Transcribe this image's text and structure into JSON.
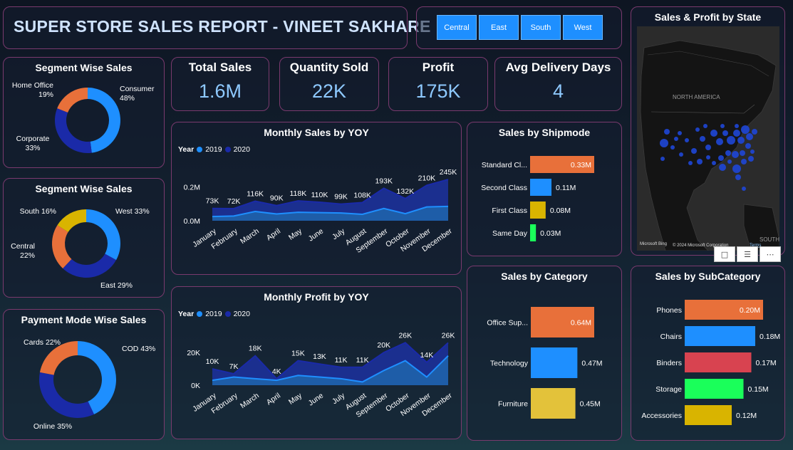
{
  "header": {
    "title": "SUPER STORE SALES REPORT - VINEET SAKHARE"
  },
  "regions": [
    "Central",
    "East",
    "South",
    "West"
  ],
  "kpis": [
    {
      "title": "Total Sales",
      "value": "1.6M"
    },
    {
      "title": "Quantity Sold",
      "value": "22K"
    },
    {
      "title": "Profit",
      "value": "175K"
    },
    {
      "title": "Avg Delivery Days",
      "value": "4"
    }
  ],
  "colors": {
    "accent_blue": "#1e8fff",
    "navy": "#1a2aa8",
    "orange": "#e8703a",
    "yellow": "#d9b400",
    "border": "#7a3a6e"
  },
  "segment_sales": {
    "title": "Segment Wise Sales",
    "slices": [
      {
        "name": "Consumer",
        "pct": "48%",
        "value": 48,
        "color": "#1e8fff"
      },
      {
        "name": "Corporate",
        "pct": "33%",
        "value": 33,
        "color": "#1a2aa8"
      },
      {
        "name": "Home Office",
        "pct": "19%",
        "value": 19,
        "color": "#e8703a"
      }
    ]
  },
  "region_sales": {
    "title": "Segment Wise Sales",
    "slices": [
      {
        "name": "West",
        "pct": "33%",
        "value": 33,
        "color": "#1e8fff"
      },
      {
        "name": "East",
        "pct": "29%",
        "value": 29,
        "color": "#1a2aa8"
      },
      {
        "name": "Central",
        "pct": "22%",
        "value": 22,
        "color": "#e8703a"
      },
      {
        "name": "South",
        "pct": "16%",
        "value": 16,
        "color": "#d9b400"
      }
    ]
  },
  "payment_sales": {
    "title": "Payment Mode Wise Sales",
    "slices": [
      {
        "name": "COD",
        "pct": "43%",
        "value": 43,
        "color": "#1e8fff"
      },
      {
        "name": "Online",
        "pct": "35%",
        "value": 35,
        "color": "#1a2aa8"
      },
      {
        "name": "Cards",
        "pct": "22%",
        "value": 22,
        "color": "#e8703a"
      }
    ]
  },
  "legend": {
    "title": "Year",
    "items": [
      {
        "label": "2019",
        "color": "#1e8fff"
      },
      {
        "label": "2020",
        "color": "#1a2aa8"
      }
    ]
  },
  "monthly_sales": {
    "title": "Monthly Sales by YOY",
    "months": [
      "January",
      "February",
      "March",
      "April",
      "May",
      "June",
      "July",
      "August",
      "September",
      "October",
      "November",
      "December"
    ],
    "s2020": [
      0.073,
      0.072,
      0.116,
      0.09,
      0.118,
      0.11,
      0.099,
      0.108,
      0.193,
      0.132,
      0.21,
      0.245
    ],
    "s2019": [
      0.025,
      0.028,
      0.055,
      0.04,
      0.05,
      0.048,
      0.046,
      0.038,
      0.073,
      0.042,
      0.082,
      0.085
    ],
    "labels": [
      "73K",
      "72K",
      "116K",
      "90K",
      "118K",
      "110K",
      "99K",
      "108K",
      "193K",
      "132K",
      "210K",
      "245K"
    ],
    "yticks": [
      "0.2M",
      "0.0M"
    ]
  },
  "monthly_profit": {
    "title": "Monthly Profit by YOY",
    "months": [
      "January",
      "February",
      "March",
      "April",
      "May",
      "June",
      "July",
      "August",
      "September",
      "October",
      "November",
      "December"
    ],
    "s2020": [
      10,
      7,
      18,
      4,
      15,
      13,
      11,
      11,
      20,
      26,
      14,
      26
    ],
    "s2019": [
      3,
      5,
      4,
      3,
      6,
      5,
      4,
      2,
      9,
      15,
      5,
      18
    ],
    "labels": [
      "10K",
      "7K",
      "18K",
      "4K",
      "15K",
      "13K",
      "11K",
      "11K",
      "20K",
      "26K",
      "14K",
      "26K"
    ],
    "yticks": [
      "20K",
      "0K"
    ]
  },
  "shipmode": {
    "title": "Sales by Shipmode",
    "bars": [
      {
        "label": "Standard Cl...",
        "value": 0.33,
        "text": "0.33M",
        "color": "#e8703a"
      },
      {
        "label": "Second Class",
        "value": 0.11,
        "text": "0.11M",
        "color": "#1e8fff"
      },
      {
        "label": "First Class",
        "value": 0.08,
        "text": "0.08M",
        "color": "#d9b400"
      },
      {
        "label": "Same Day",
        "value": 0.03,
        "text": "0.03M",
        "color": "#1aff5a"
      }
    ]
  },
  "category": {
    "title": "Sales by Category",
    "bars": [
      {
        "label": "Office Sup...",
        "value": 0.64,
        "text": "0.64M",
        "color": "#e8703a"
      },
      {
        "label": "Technology",
        "value": 0.47,
        "text": "0.47M",
        "color": "#1e8fff"
      },
      {
        "label": "Furniture",
        "value": 0.45,
        "text": "0.45M",
        "color": "#e3c23a"
      }
    ]
  },
  "subcategory": {
    "title": "Sales by SubCategory",
    "bars": [
      {
        "label": "Phones",
        "value": 0.2,
        "text": "0.20M",
        "color": "#e8703a"
      },
      {
        "label": "Chairs",
        "value": 0.18,
        "text": "0.18M",
        "color": "#1e8fff"
      },
      {
        "label": "Binders",
        "value": 0.17,
        "text": "0.17M",
        "color": "#d84350"
      },
      {
        "label": "Storage",
        "value": 0.15,
        "text": "0.15M",
        "color": "#1aff5a"
      },
      {
        "label": "Accessories",
        "value": 0.12,
        "text": "0.12M",
        "color": "#d9b400"
      }
    ]
  },
  "map": {
    "title": "Sales & Profit by State",
    "region_label": "NORTH AMERICA",
    "south_label": "SOUTH",
    "brand": "Microsoft Bing",
    "copyright": "© 2024 Microsoft Corporation",
    "terms": "Terms"
  }
}
